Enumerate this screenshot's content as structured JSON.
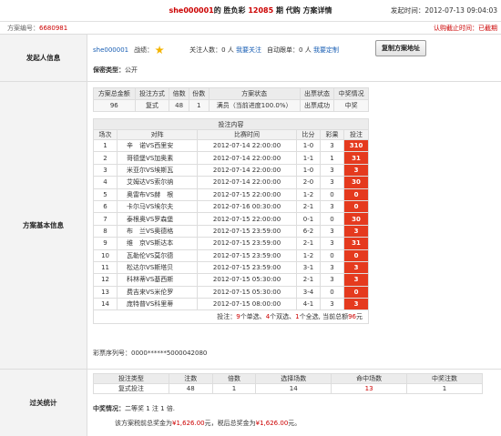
{
  "header": {
    "user": "she000001",
    "lottery_prefix": "的 胜负彩 ",
    "issue": "12085",
    "title_suffix": " 期 代购 方案详情",
    "time_label": "发起时间：",
    "time_value": "2012-07-13 09:04:03"
  },
  "subheader": {
    "plan_no_label": "方案编号：",
    "plan_no": "6680981",
    "status": "认购截止时间：已截期"
  },
  "initiator": {
    "section_label": "发起人信息",
    "user": "she000001",
    "record_label": "战绩：",
    "followers_label": "关注人数：",
    "followers_value": "0 人",
    "follow_link": "我要关注",
    "auto_label": "自动跟单：",
    "auto_value": "0 人",
    "auto_link": "我要定制",
    "copy_button": "复制方案地址",
    "privacy_label": "保密类型：",
    "privacy_value": "公开"
  },
  "basic": {
    "section_label": "方案基本信息",
    "summary_headers": [
      "方案总金额",
      "投注方式",
      "倍数",
      "份数",
      "方案状态",
      "出票状态",
      "中奖情况"
    ],
    "summary_row": [
      "96",
      "复式",
      "48",
      "1",
      "满员（当前进度100.0%）",
      "出票成功",
      "中奖"
    ],
    "content_title": "投注内容",
    "match_headers": [
      "场次",
      "对阵",
      "比赛时间",
      "比分",
      "彩果",
      "投注"
    ],
    "matches": [
      [
        "1",
        "辛　诺VS西里安",
        "2012-07-14 22:00:00",
        "1-0",
        "3",
        "310"
      ],
      [
        "2",
        "哥德堡VS加奥素",
        "2012-07-14 22:00:00",
        "1-1",
        "1",
        "31"
      ],
      [
        "3",
        "米亚尔VS埃斯瓦",
        "2012-07-14 22:00:00",
        "1-0",
        "3",
        "3"
      ],
      [
        "4",
        "艾姆达VS索尔纳",
        "2012-07-14 22:00:00",
        "2-0",
        "3",
        "30"
      ],
      [
        "5",
        "奥雷布VS赫　根",
        "2012-07-15 22:00:00",
        "1-2",
        "0",
        "0"
      ],
      [
        "6",
        "卡尔马VS埃尔夫",
        "2012-07-16 00:30:00",
        "2-1",
        "3",
        "0"
      ],
      [
        "7",
        "泰根奥VS罗森堡",
        "2012-07-15 22:00:00",
        "0-1",
        "0",
        "30"
      ],
      [
        "8",
        "布　兰VS奥德格",
        "2012-07-15 23:59:00",
        "6-2",
        "3",
        "3"
      ],
      [
        "9",
        "维　京VS斯达本",
        "2012-07-15 23:59:00",
        "2-1",
        "3",
        "31"
      ],
      [
        "10",
        "瓦勒伦VS莫尔德",
        "2012-07-15 23:59:00",
        "1-2",
        "0",
        "0"
      ],
      [
        "11",
        "松达尔VS斯塔贝",
        "2012-07-15 23:59:00",
        "3-1",
        "3",
        "3"
      ],
      [
        "12",
        "科林蒂VS基西斯",
        "2012-07-15 05:30:00",
        "2-1",
        "3",
        "3"
      ],
      [
        "13",
        "费吉来VS米伦罗",
        "2012-07-15 05:30:00",
        "3-4",
        "0",
        "0"
      ],
      [
        "14",
        "庞特普VS科里蒂",
        "2012-07-15 08:00:00",
        "4-1",
        "3",
        "3"
      ]
    ],
    "footer": {
      "p1": "投注：",
      "singles": "9",
      "p2": "个单选、",
      "doubles": "4",
      "p3": "个双选、",
      "triples": "1",
      "p4": "个全选, 当前总额",
      "amount": "96",
      "p5": "元"
    },
    "serial_label": "彩票序列号：",
    "serial_value": "0000******5000042080"
  },
  "settlement": {
    "section_label": "过关统计",
    "headers": [
      "投注类型",
      "注数",
      "倍数",
      "选择场数",
      "命中场数",
      "中奖注数"
    ],
    "row": [
      "复式投注",
      "48",
      "1",
      "14",
      "13",
      "1"
    ],
    "prize_label": "中奖情况：",
    "prize_text": "二等奖 1 注 1 倍.",
    "tax_p1": "该方案税前总奖金为",
    "tax_before": "¥1,626.00",
    "tax_p2": "元，税后总奖金为",
    "tax_after": "¥1,626.00",
    "tax_p3": "元。"
  },
  "colors": {
    "accent_red": "#c00000",
    "bet_cell": "#e53a1e",
    "link_blue": "#1a5fb4"
  }
}
